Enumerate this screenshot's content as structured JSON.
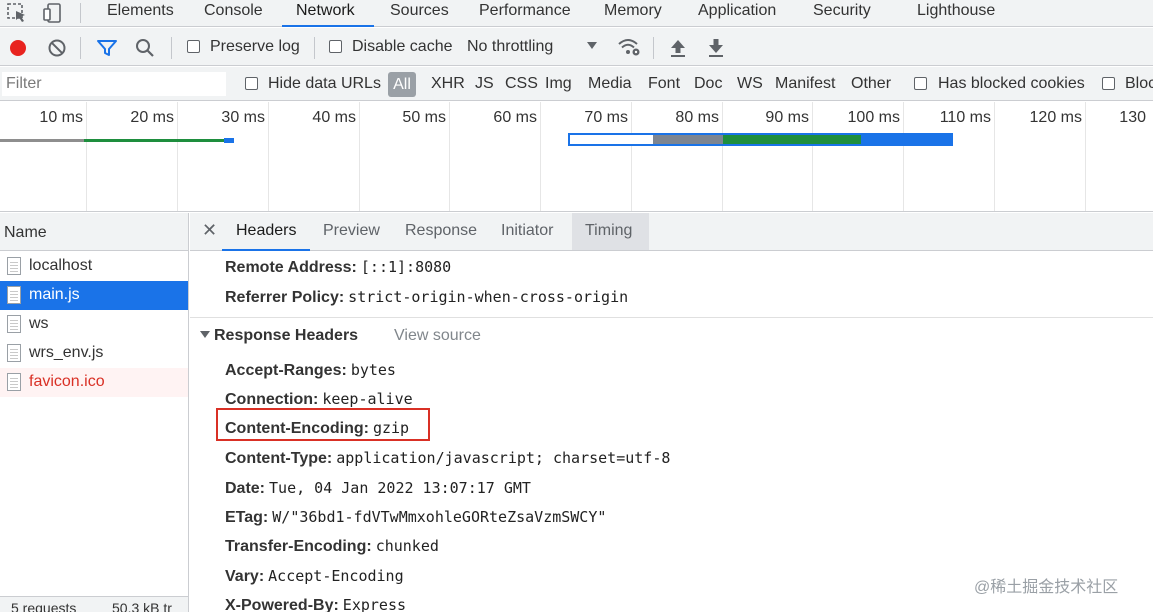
{
  "topbar": {
    "tabs": [
      "Elements",
      "Console",
      "Network",
      "Sources",
      "Performance",
      "Memory",
      "Application",
      "Security",
      "Lighthouse"
    ],
    "active_tab": "Network",
    "icons": [
      "inspect-element-icon",
      "device-toolbar-icon"
    ]
  },
  "toolbar": {
    "preserve_log": "Preserve log",
    "disable_cache": "Disable cache",
    "throttling": "No throttling",
    "colors": {
      "record": "#e8231f",
      "filter_active": "#1a73e8"
    }
  },
  "filterbar": {
    "filter_placeholder": "Filter",
    "hide_data_urls": "Hide data URLs",
    "types": [
      "All",
      "XHR",
      "JS",
      "CSS",
      "Img",
      "Media",
      "Font",
      "Doc",
      "WS",
      "Manifest",
      "Other"
    ],
    "has_blocked_cookies": "Has blocked cookies",
    "blocked_requests": "Bloc"
  },
  "overview": {
    "ticks": [
      "10 ms",
      "20 ms",
      "30 ms",
      "40 ms",
      "50 ms",
      "60 ms",
      "70 ms",
      "80 ms",
      "90 ms",
      "100 ms",
      "110 ms",
      "120 ms",
      "130"
    ]
  },
  "requests": {
    "header": "Name",
    "items": [
      {
        "name": "localhost",
        "state": "normal"
      },
      {
        "name": "main.js",
        "state": "selected"
      },
      {
        "name": "ws",
        "state": "normal"
      },
      {
        "name": "wrs_env.js",
        "state": "normal"
      },
      {
        "name": "favicon.ico",
        "state": "error"
      }
    ],
    "status_requests": "5 requests",
    "status_transferred": "50.3 kB tr"
  },
  "detail": {
    "tabs": [
      "Headers",
      "Preview",
      "Response",
      "Initiator",
      "Timing"
    ],
    "active_tab": "Headers",
    "general": [
      {
        "key": "Remote Address:",
        "value": "[::1]:8080"
      },
      {
        "key": "Referrer Policy:",
        "value": "strict-origin-when-cross-origin"
      }
    ],
    "response_section_title": "Response Headers",
    "view_source": "View source",
    "response_headers": [
      {
        "key": "Accept-Ranges:",
        "value": "bytes"
      },
      {
        "key": "Connection:",
        "value": "keep-alive"
      },
      {
        "key": "Content-Encoding:",
        "value": "gzip"
      },
      {
        "key": "Content-Type:",
        "value": "application/javascript; charset=utf-8"
      },
      {
        "key": "Date:",
        "value": "Tue, 04 Jan 2022 13:07:17 GMT"
      },
      {
        "key": "ETag:",
        "value": "W/\"36bd1-fdVTwMmxohleGORteZsaVzmSWCY\""
      },
      {
        "key": "Transfer-Encoding:",
        "value": "chunked"
      },
      {
        "key": "Vary:",
        "value": "Accept-Encoding"
      },
      {
        "key": "X-Powered-By:",
        "value": "Express"
      }
    ],
    "highlighted_header": "Content-Encoding:",
    "highlight_color": "#d93025"
  },
  "watermark": "@稀土掘金技术社区"
}
